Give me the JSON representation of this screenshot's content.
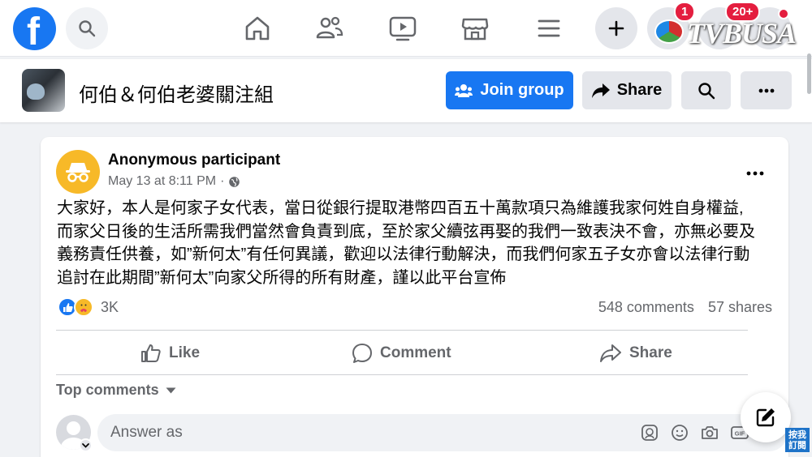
{
  "topbar": {
    "logo_letter": "f",
    "notification_badge": "1",
    "messages_badge": "20+",
    "watermark": "TVBUSA"
  },
  "group": {
    "name": "何伯＆何伯老婆關注組",
    "join_label": "Join group",
    "share_label": "Share"
  },
  "post": {
    "author": "Anonymous participant",
    "timestamp": "May 13 at 8:11 PM",
    "separator": "·",
    "text_lines": [
      "大家好，本人是何家子女代表，當日從銀行提取港幣四百五十萬款項只為維護我家何姓自身權益,",
      "而家父日後的生活所需我們當然會負責到底，至於家父續弦再娶的我們一致表決不會，亦無必要及",
      "義務責任供養，如”新何太”有任何異議，歡迎以法律行動解決，而我們何家五子女亦會以法律行動",
      "追討在此期間”新何太”向家父所得的所有財產，謹以此平台宣佈"
    ],
    "reaction_count": "3K",
    "comments_count": "548 comments",
    "shares_count": "57 shares",
    "actions": {
      "like": "Like",
      "comment": "Comment",
      "share": "Share"
    },
    "top_comments_label": "Top comments",
    "comment_placeholder": "Answer as"
  },
  "overlay": {
    "subscribe_badge": "按我訂閱"
  },
  "colors": {
    "brand": "#1877f2",
    "text_secondary": "#65676b",
    "anon_avatar": "#f7b928"
  }
}
